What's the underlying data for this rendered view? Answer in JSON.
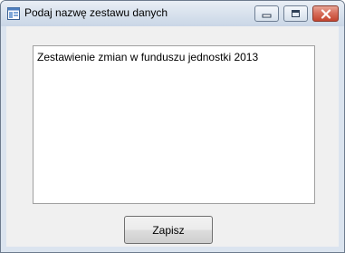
{
  "window": {
    "title": "Podaj nazwę zestawu danych",
    "icon": "app-window-icon",
    "controls": [
      "minimize-icon",
      "maximize-icon",
      "close-icon"
    ]
  },
  "dialog": {
    "text_value": "Zestawienie zmian w funduszu jednostki 2013",
    "save_label": "Zapisz"
  },
  "colors": {
    "close_button": "#c3452f",
    "titlebar": "#dae3ee"
  }
}
